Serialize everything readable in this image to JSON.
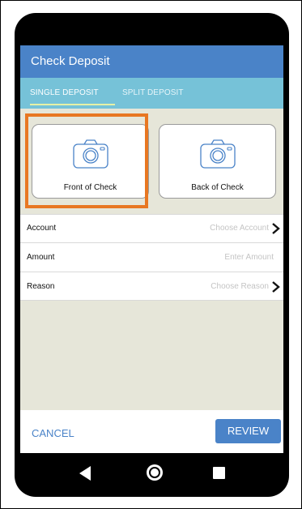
{
  "header": {
    "title": "Check Deposit"
  },
  "tabs": [
    {
      "label": "SINGLE DEPOSIT",
      "active": true
    },
    {
      "label": "SPLIT DEPOSIT",
      "active": false
    }
  ],
  "capture": {
    "front_label": "Front of Check",
    "back_label": "Back of Check",
    "icon": "camera-icon"
  },
  "form": {
    "rows": [
      {
        "label": "Account",
        "value": "Choose Account",
        "icon": "chevron-right-icon"
      },
      {
        "label": "Amount",
        "value": "Enter Amount"
      },
      {
        "label": "Reason",
        "value": "Choose Reason",
        "icon": "chevron-right-icon"
      }
    ]
  },
  "footer": {
    "cancel_label": "CANCEL",
    "review_label": "REVIEW"
  },
  "colors": {
    "primary": "#4a83c8",
    "tab_bar": "#76c2d8",
    "highlight": "#e87722",
    "background": "#e6e6d9"
  },
  "nav": {
    "back_icon": "back-triangle-icon",
    "home_icon": "home-circle-icon",
    "recent_icon": "recent-apps-icon"
  }
}
